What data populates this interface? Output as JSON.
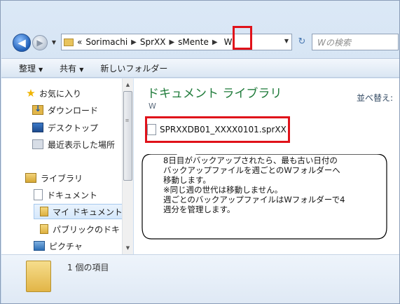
{
  "address_bar": {
    "overflow": "«",
    "crumbs": [
      "Sorimachi",
      "SprXX",
      "sMente",
      "W"
    ],
    "search_placeholder": "Wの検索"
  },
  "toolbar": {
    "organize": "整理",
    "share": "共有",
    "new_folder": "新しいフォルダー"
  },
  "nav": {
    "favorites": "お気に入り",
    "downloads": "ダウンロード",
    "desktop": "デスクトップ",
    "recent": "最近表示した場所",
    "libraries": "ライブラリ",
    "documents": "ドキュメント",
    "my_documents": "マイ ドキュメント",
    "public_documents": "パブリックのドキ",
    "pictures": "ピクチャ"
  },
  "content": {
    "library_title": "ドキュメント ライブラリ",
    "library_subtitle": "W",
    "arrange_label": "並べ替え:",
    "files": [
      {
        "name": "SPRXXDB01_XXXX0101.sprXX"
      }
    ]
  },
  "callout": {
    "lines": [
      "8日目がバックアップされたら、最も古い日付の",
      "バックアップファイルを週ごとのWフォルダーへ",
      "移動します。",
      "※同じ週の世代は移動しません。",
      "週ごとのバックアップファイルはWフォルダーで4",
      "週分を管理します。"
    ]
  },
  "status": {
    "item_count": "1 個の項目"
  },
  "colors": {
    "highlight_box": "#e0121a",
    "library_title": "#1f7b3a"
  }
}
